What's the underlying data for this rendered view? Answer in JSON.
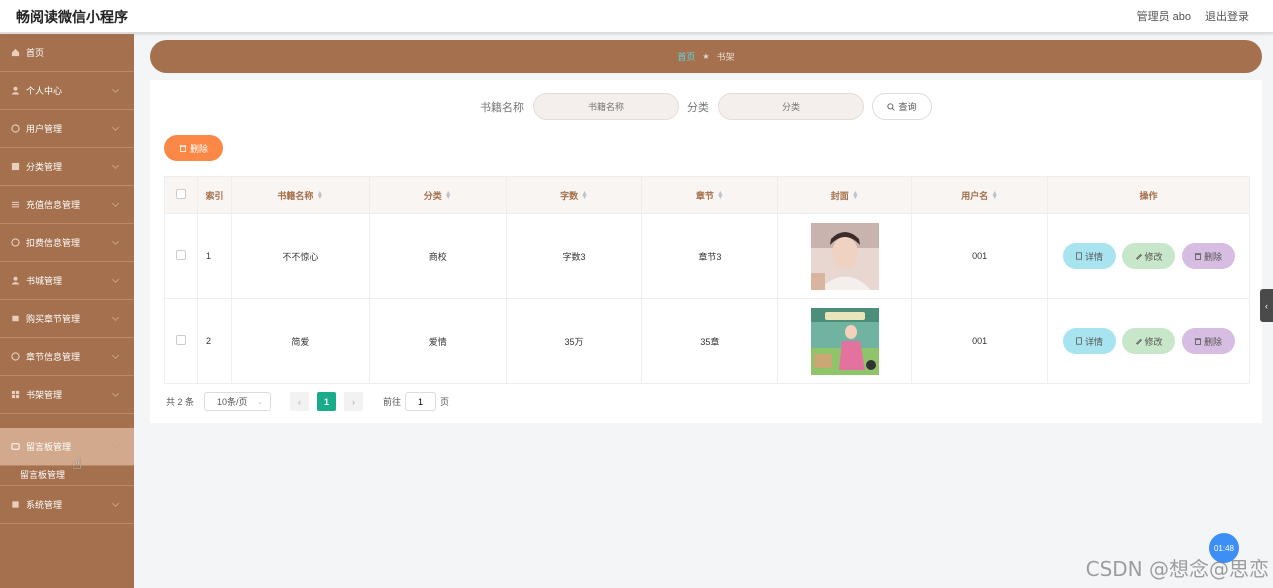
{
  "app": {
    "title": "畅阅读微信小程序"
  },
  "header": {
    "user": "管理员 abo",
    "logout": "退出登录"
  },
  "sidebar": {
    "items": [
      {
        "label": "首页",
        "icon": "home-icon"
      },
      {
        "label": "个人中心",
        "icon": "user-icon"
      },
      {
        "label": "用户管理",
        "icon": "users-icon"
      },
      {
        "label": "分类管理",
        "icon": "category-icon"
      },
      {
        "label": "充值信息管理",
        "icon": "list-icon"
      },
      {
        "label": "扣费信息管理",
        "icon": "info-icon"
      },
      {
        "label": "书城管理",
        "icon": "user-icon"
      },
      {
        "label": "购买章节管理",
        "icon": "cart-icon"
      },
      {
        "label": "章节信息管理",
        "icon": "info-icon"
      },
      {
        "label": "书架管理",
        "icon": "grid-icon"
      },
      {
        "label": "留言板管理",
        "icon": "message-icon"
      },
      {
        "label": "系统管理",
        "icon": "settings-icon"
      }
    ],
    "submenu_label": "留言板管理"
  },
  "breadcrumb": {
    "home": "首页",
    "separator": "★",
    "current": "书架"
  },
  "search": {
    "name_label": "书籍名称",
    "name_placeholder": "书籍名称",
    "category_label": "分类",
    "category_placeholder": "分类",
    "button": "查询"
  },
  "toolbar": {
    "delete_label": "删除"
  },
  "table": {
    "headers": [
      "索引",
      "书籍名称",
      "分类",
      "字数",
      "章节",
      "封面",
      "用户名",
      "操作"
    ],
    "rows": [
      {
        "index": "1",
        "name": "不不惊心",
        "category": "商校",
        "words": "字数3",
        "chapter": "章节3",
        "username": "001"
      },
      {
        "index": "2",
        "name": "简爱",
        "category": "爱情",
        "words": "35万",
        "chapter": "35章",
        "username": "001"
      }
    ],
    "actions": {
      "detail": "详情",
      "edit": "修改",
      "delete": "删除"
    }
  },
  "pagination": {
    "total": "共 2 条",
    "page_size": "10条/页",
    "prev": "‹",
    "current_page": "1",
    "next": "›",
    "goto_label": "前往",
    "goto_value": "1",
    "page_unit": "页"
  },
  "overlay": {
    "clock": "01:48",
    "watermark": "CSDN @想念@思恋",
    "side_tab": "‹"
  },
  "colors": {
    "sidebar": "#a4704d",
    "accent_orange": "#fb8847",
    "page_active": "#1aab8a"
  }
}
